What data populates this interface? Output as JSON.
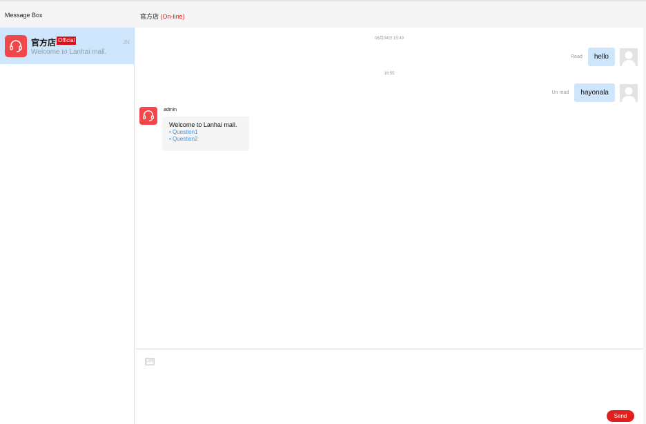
{
  "header": {
    "left_title": "Message Box",
    "chat_title": "官方店",
    "chat_status": "(On-line)"
  },
  "sidebar": {
    "conversations": [
      {
        "name": "官方店",
        "badge": "Official",
        "preview": "Welcome to Lanhai mall.",
        "time": "JN",
        "avatar_icon": "headset-icon",
        "selected": true
      }
    ]
  },
  "chat": {
    "timestamps": [
      "06月04日 15:49",
      "16:55"
    ],
    "outgoing": [
      {
        "text": "hello",
        "status": "Read",
        "avatar_icon": "user-placeholder-icon"
      },
      {
        "text": "hayonala",
        "status": "Un read",
        "avatar_icon": "user-placeholder-icon"
      }
    ],
    "incoming": {
      "sender": "admin",
      "avatar_icon": "headset-icon",
      "intro": "Welcome to Lanhai mall.",
      "questions": [
        "• Question1",
        "• Question2"
      ]
    }
  },
  "composer": {
    "image_icon": "image-icon",
    "send_label": "Send"
  },
  "colors": {
    "accent_red": "#e02020",
    "selected_bg": "#cfe5fb",
    "link_blue": "#3f8de0",
    "avatar_red": "#f0474b"
  }
}
